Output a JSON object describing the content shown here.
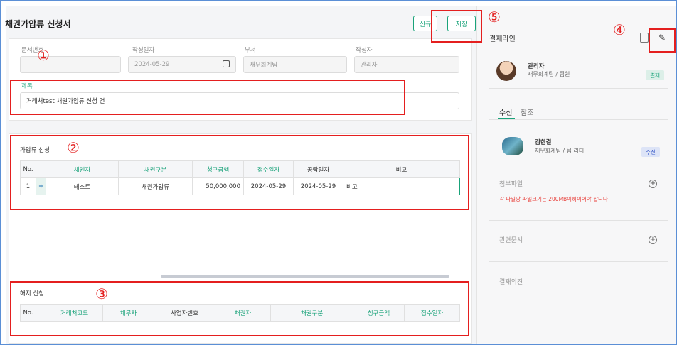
{
  "page": {
    "title": "채권가압류 신청서"
  },
  "toolbar": {
    "new_label": "신규",
    "save_label": "저장"
  },
  "doc_info": {
    "doc_no_label": "문서번호",
    "date_label": "작성일자",
    "date_value": "2024-05-29",
    "dept_label": "부서",
    "dept_value": "재무회계팀",
    "author_label": "작성자",
    "author_value": "관리자",
    "subject_label": "제목",
    "subject_value": "거래처test 채권가압류 신청 건"
  },
  "seizure": {
    "title": "가압류 신청",
    "headers": [
      "No.",
      "",
      "채권자",
      "채권구분",
      "청구금액",
      "접수일자",
      "공탁일자",
      "비고"
    ],
    "rows": [
      {
        "no": "1",
        "creditor": "테스트",
        "type": "채권가압류",
        "amount": "50,000,000",
        "received": "2024-05-29",
        "deposit": "2024-05-29",
        "note": "비고"
      }
    ]
  },
  "release": {
    "title": "해지 신청",
    "headers": [
      "No.",
      "",
      "거래처코드",
      "채무자",
      "사업자번호",
      "채권자",
      "채권구분",
      "청구금액",
      "접수일자"
    ]
  },
  "approval": {
    "title": "결재라인",
    "approver_name": "관리자",
    "approver_dept": "재무회계팀 / 팀원",
    "approver_badge": "결재",
    "tab_receive": "수신",
    "tab_reference": "참조",
    "receiver_name": "김한결",
    "receiver_dept": "재무회계팀 / 팀 리더",
    "receiver_badge": "수신",
    "attachment_title": "첨부파일",
    "attachment_note": "각 파일당 파일크기는 200MB이하이어야 합니다",
    "related_title": "관련문서",
    "opinion_title": "결재의견"
  },
  "markers": {
    "m1": "①",
    "m2": "②",
    "m3": "③",
    "m4": "④",
    "m5": "⑤"
  },
  "colors": {
    "accent": "#1aa37a",
    "annotation": "#e41f1f",
    "note": "#e8413c"
  }
}
